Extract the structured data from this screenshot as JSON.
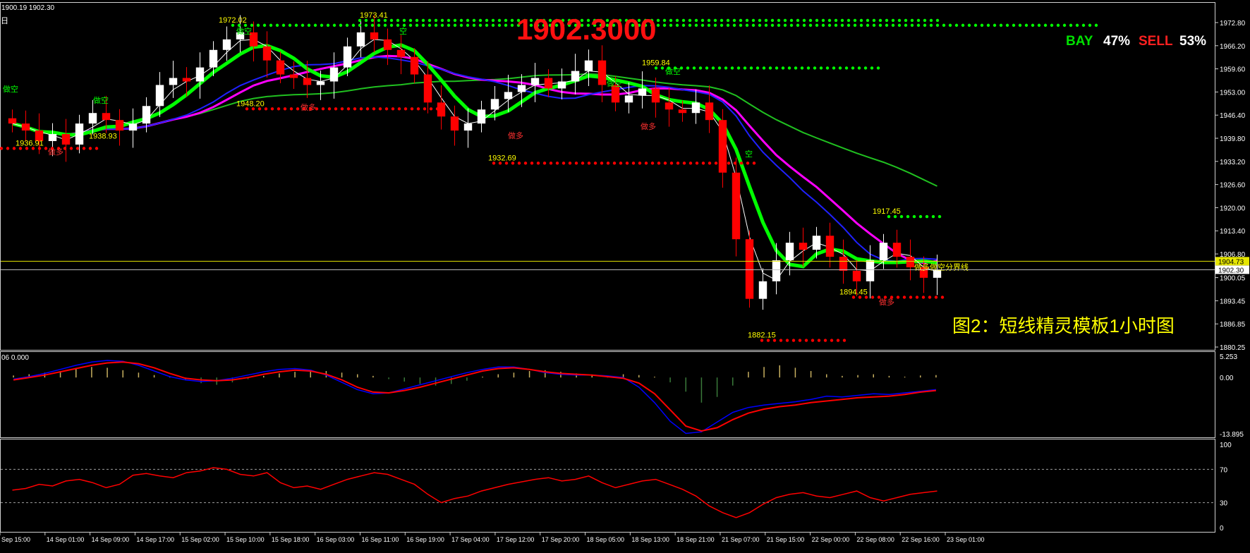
{
  "header": {
    "info": "1900.19 1902.30",
    "timeframe_label": "日",
    "big_price": "1902.3000",
    "bay_label": "BAY",
    "bay_pct": "47%",
    "sell_label": "SELL",
    "sell_pct": "53%"
  },
  "caption": "图2：短线精灵模板1小时图",
  "colors": {
    "background": "#000000",
    "bull_candle": "#ffffff",
    "bear_candle": "#ff0000",
    "sell_ma": "#00ff00",
    "buy_dots": "#ff0000",
    "resistance_dots": "#00ff00",
    "ma_blue": "#2020ff",
    "ma_magenta": "#ff00ff",
    "ma_green": "#20c020",
    "ask_line": "#e6e600",
    "bid_line": "#c0c0c0",
    "label_yellow": "#ffff00",
    "macd_signal": "#ff0000",
    "macd_line": "#0000ff",
    "rsi_line": "#ff0000",
    "axis_text": "#ffffff"
  },
  "price_axis": {
    "ticks": [
      "1972.80",
      "1966.20",
      "1959.60",
      "1953.00",
      "1946.40",
      "1939.80",
      "1933.20",
      "1926.60",
      "1920.00",
      "1913.40",
      "1906.80",
      "1900.05",
      "1893.45",
      "1886.85",
      "1880.25"
    ],
    "ask_tag": "1904.73",
    "bid_tag": "1902.30",
    "min": 1880.25,
    "max": 1972.8
  },
  "macd_panel": {
    "label": "06 0.000",
    "ticks": [
      "5.253",
      "0.00",
      "-13.895"
    ],
    "min": -13.895,
    "max": 5.253
  },
  "rsi_panel": {
    "ticks": [
      "100",
      "70",
      "30",
      "0"
    ],
    "levels": [
      70,
      30
    ]
  },
  "time_axis": {
    "labels": [
      "Sep 15:00",
      "14 Sep 01:00",
      "14 Sep 09:00",
      "14 Sep 17:00",
      "15 Sep 02:00",
      "15 Sep 10:00",
      "15 Sep 18:00",
      "16 Sep 03:00",
      "16 Sep 11:00",
      "16 Sep 19:00",
      "17 Sep 04:00",
      "17 Sep 12:00",
      "17 Sep 20:00",
      "18 Sep 05:00",
      "18 Sep 13:00",
      "18 Sep 21:00",
      "21 Sep 07:00",
      "21 Sep 15:00",
      "22 Sep 00:00",
      "22 Sep 08:00",
      "22 Sep 16:00",
      "23 Sep 01:00"
    ]
  },
  "annotations": {
    "price_labels": [
      {
        "text": "1972.02",
        "value": 1972.02
      },
      {
        "text": "1973.41",
        "value": 1973.41
      },
      {
        "text": "1959.84",
        "value": 1959.84
      },
      {
        "text": "1948.20",
        "value": 1948.2
      },
      {
        "text": "1936.91",
        "value": 1936.91
      },
      {
        "text": "1938.93",
        "value": 1938.93
      },
      {
        "text": "1932.69",
        "value": 1932.69
      },
      {
        "text": "1917.45",
        "value": 1917.45
      },
      {
        "text": "1894.45",
        "value": 1894.45
      },
      {
        "text": "1882.15",
        "value": 1882.15
      }
    ],
    "signal_words": {
      "short": "做空",
      "long": "做多",
      "short_alt": "空",
      "boundary": "做多做空分界线"
    }
  },
  "chart_data": {
    "type": "candlestick",
    "title": "1902.3000",
    "current_price": 1902.3,
    "ask_price": 1904.73,
    "ylim": [
      1880.25,
      1972.8
    ],
    "x_labels": [
      "Sep 15:00",
      "14 Sep 01:00",
      "14 Sep 09:00",
      "14 Sep 17:00",
      "15 Sep 02:00",
      "15 Sep 10:00",
      "15 Sep 18:00",
      "16 Sep 03:00",
      "16 Sep 11:00",
      "16 Sep 19:00",
      "17 Sep 04:00",
      "17 Sep 12:00",
      "17 Sep 20:00",
      "18 Sep 05:00",
      "18 Sep 13:00",
      "18 Sep 21:00",
      "21 Sep 07:00",
      "21 Sep 15:00",
      "22 Sep 00:00",
      "22 Sep 08:00",
      "22 Sep 16:00",
      "23 Sep 01:00"
    ],
    "close_series": [
      1944,
      1942,
      1939,
      1941,
      1938,
      1944,
      1947,
      1945,
      1942,
      1944,
      1949,
      1955,
      1957,
      1956,
      1960,
      1965,
      1968,
      1970,
      1966,
      1962,
      1958,
      1957,
      1955,
      1956,
      1960,
      1966,
      1970,
      1968,
      1965,
      1963,
      1958,
      1950,
      1946,
      1942,
      1944,
      1948,
      1951,
      1953,
      1955,
      1957,
      1954,
      1956,
      1959,
      1962,
      1955,
      1950,
      1952,
      1954,
      1950,
      1948,
      1947,
      1950,
      1945,
      1930,
      1911,
      1894,
      1899,
      1905,
      1910,
      1908,
      1912,
      1906,
      1902,
      1899,
      1905,
      1910,
      1906,
      1903,
      1900,
      1902.3
    ],
    "support_levels": [
      1948.2,
      1936.91,
      1932.69,
      1894.45,
      1882.15
    ],
    "resistance_levels": [
      1972.02,
      1973.41,
      1959.84,
      1917.45
    ],
    "macd": {
      "ylim": [
        -13.895,
        5.253
      ],
      "histogram": [
        0.5,
        0.8,
        1.2,
        1.6,
        2.2,
        2.6,
        2.4,
        1.8,
        1.2,
        0.6,
        0.2,
        -0.6,
        -1.4,
        -1.8,
        -1.2,
        -0.4,
        0.4,
        1.0,
        1.4,
        1.8,
        1.6,
        1.2,
        0.8,
        0.4,
        -0.4,
        -1.0,
        -1.6,
        -2.0,
        -1.6,
        -0.8,
        0.2,
        0.8,
        1.2,
        1.6,
        1.8,
        1.4,
        1.0,
        0.6,
        0.4,
        0.8,
        0.6,
        0.2,
        -1.2,
        -3.5,
        -6.2,
        -4.8,
        -2.0,
        1.4,
        2.6,
        3.0,
        2.4,
        1.6,
        0.8,
        0.4,
        0.6,
        0.8,
        0.4,
        0.2,
        0.5,
        0.6
      ],
      "signal": [
        -0.6,
        0.0,
        0.6,
        1.4,
        2.2,
        3.0,
        3.6,
        3.8,
        3.4,
        2.4,
        1.0,
        -0.2,
        -0.6,
        -0.8,
        -0.6,
        0.0,
        0.8,
        1.4,
        1.8,
        1.6,
        0.8,
        -0.6,
        -2.4,
        -3.6,
        -3.8,
        -3.2,
        -2.4,
        -1.4,
        -0.4,
        0.6,
        1.6,
        2.2,
        2.4,
        2.0,
        1.4,
        1.0,
        0.8,
        0.6,
        0.2,
        -0.2,
        -1.4,
        -4.0,
        -8.0,
        -12.0,
        -13.2,
        -12.4,
        -10.4,
        -8.8,
        -7.8,
        -7.2,
        -6.8,
        -6.2,
        -5.8,
        -5.4,
        -5.0,
        -4.8,
        -4.6,
        -4.2,
        -3.6,
        -3.2
      ],
      "macd_line": [
        -0.4,
        0.2,
        1.0,
        2.0,
        3.0,
        3.8,
        4.2,
        4.0,
        3.0,
        1.6,
        0.2,
        -0.6,
        -1.0,
        -0.8,
        -0.2,
        0.6,
        1.4,
        2.0,
        2.2,
        1.8,
        0.6,
        -1.2,
        -3.0,
        -4.0,
        -3.8,
        -2.8,
        -1.8,
        -0.8,
        0.2,
        1.2,
        2.0,
        2.6,
        2.6,
        2.0,
        1.2,
        0.8,
        0.6,
        0.6,
        0.4,
        0.0,
        -2.4,
        -6.2,
        -10.8,
        -13.8,
        -13.4,
        -11.0,
        -8.6,
        -7.4,
        -6.8,
        -6.4,
        -6.0,
        -5.4,
        -4.6,
        -4.8,
        -4.4,
        -4.0,
        -4.2,
        -3.8,
        -3.4,
        -3.0
      ]
    },
    "rsi": {
      "ylim": [
        0,
        100
      ],
      "levels": [
        70,
        30
      ],
      "values": [
        45,
        47,
        52,
        50,
        56,
        58,
        54,
        48,
        52,
        63,
        65,
        62,
        60,
        66,
        68,
        72,
        70,
        64,
        62,
        66,
        54,
        48,
        50,
        46,
        52,
        58,
        62,
        66,
        64,
        58,
        52,
        40,
        30,
        35,
        38,
        44,
        48,
        52,
        55,
        58,
        60,
        56,
        58,
        62,
        54,
        48,
        52,
        56,
        58,
        52,
        46,
        38,
        26,
        18,
        12,
        18,
        28,
        36,
        40,
        42,
        38,
        36,
        40,
        44,
        36,
        32,
        36,
        40,
        42,
        44
      ]
    }
  }
}
